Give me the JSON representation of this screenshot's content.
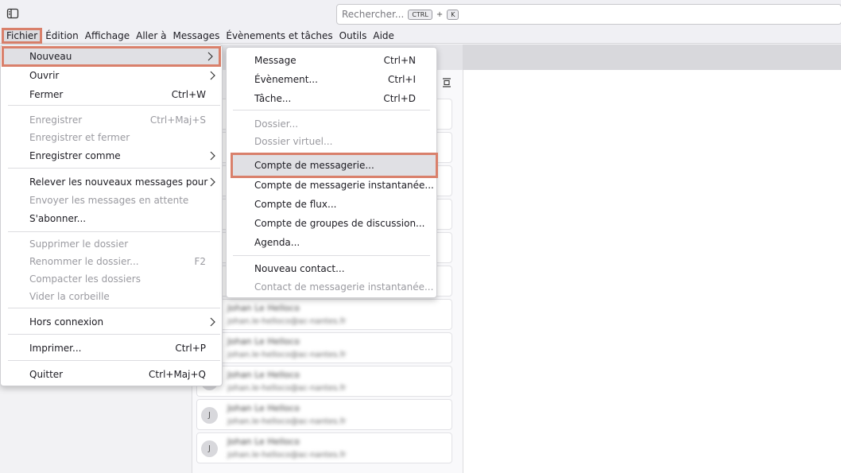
{
  "search": {
    "placeholder": "Rechercher...",
    "key1": "CTRL",
    "plus": "+",
    "key2": "K"
  },
  "menubar": [
    {
      "label": "Fichier",
      "active": true
    },
    {
      "label": "Édition"
    },
    {
      "label": "Affichage"
    },
    {
      "label": "Aller à"
    },
    {
      "label": "Messages"
    },
    {
      "label": "Évènements et tâches"
    },
    {
      "label": "Outils"
    },
    {
      "label": "Aide"
    }
  ],
  "file_menu": {
    "items": [
      {
        "label": "Nouveau",
        "shortcut": "",
        "submenu": true,
        "highlighted": true
      },
      {
        "label": "Ouvrir",
        "shortcut": "",
        "submenu": true
      },
      {
        "label": "Fermer",
        "shortcut": "Ctrl+W"
      },
      {
        "label": "Enregistrer",
        "shortcut": "Ctrl+Maj+S",
        "disabled": true
      },
      {
        "label": "Enregistrer et fermer",
        "shortcut": "",
        "disabled": true
      },
      {
        "label": "Enregistrer comme",
        "shortcut": "",
        "submenu": true
      },
      {
        "label": "Relever les nouveaux messages pour",
        "shortcut": "",
        "submenu": true
      },
      {
        "label": "Envoyer les messages en attente",
        "shortcut": "",
        "disabled": true
      },
      {
        "label": "S'abonner...",
        "shortcut": ""
      },
      {
        "label": "Supprimer le dossier",
        "shortcut": "",
        "disabled": true
      },
      {
        "label": "Renommer le dossier...",
        "shortcut": "F2",
        "disabled": true
      },
      {
        "label": "Compacter les dossiers",
        "shortcut": "",
        "disabled": true
      },
      {
        "label": "Vider la corbeille",
        "shortcut": "",
        "disabled": true
      },
      {
        "label": "Hors connexion",
        "shortcut": "",
        "submenu": true
      },
      {
        "label": "Imprimer...",
        "shortcut": "Ctrl+P"
      },
      {
        "label": "Quitter",
        "shortcut": "Ctrl+Maj+Q"
      }
    ]
  },
  "new_submenu": {
    "items": [
      {
        "label": "Message",
        "shortcut": "Ctrl+N"
      },
      {
        "label": "Évènement...",
        "shortcut": "Ctrl+I"
      },
      {
        "label": "Tâche...",
        "shortcut": "Ctrl+D"
      },
      {
        "label": "Dossier...",
        "shortcut": "",
        "disabled": true
      },
      {
        "label": "Dossier virtuel...",
        "shortcut": "",
        "disabled": true
      },
      {
        "label": "Compte de messagerie...",
        "shortcut": "",
        "highlighted": true
      },
      {
        "label": "Compte de messagerie instantanée...",
        "shortcut": ""
      },
      {
        "label": "Compte de flux...",
        "shortcut": ""
      },
      {
        "label": "Compte de groupes de discussion...",
        "shortcut": ""
      },
      {
        "label": "Agenda...",
        "shortcut": ""
      },
      {
        "label": "Nouveau contact...",
        "shortcut": ""
      },
      {
        "label": "Contact de messagerie instantanée...",
        "shortcut": "",
        "disabled": true
      }
    ]
  },
  "contacts": [
    {
      "avatar": "",
      "name": "",
      "email": ""
    },
    {
      "avatar": "",
      "name": "",
      "email": ""
    },
    {
      "avatar": "",
      "name": "",
      "email": ""
    },
    {
      "avatar": "",
      "name": "",
      "email": ""
    },
    {
      "avatar": "",
      "name": "",
      "email": ""
    },
    {
      "avatar": "",
      "name": "",
      "email": ""
    },
    {
      "avatar": "",
      "name": "Johan Le Helloco",
      "email": "johan.le-helloco@ac-nantes.fr"
    },
    {
      "avatar": "",
      "name": "Johan Le Helloco",
      "email": "johan.le-helloco@ac-nantes.fr"
    },
    {
      "avatar": "",
      "name": "Johan Le Helloco",
      "email": "johan.le-helloco@ac-nantes.fr"
    },
    {
      "avatar": "J",
      "name": "Johan Le Helloco",
      "email": "johan.le-helloco@ac-nantes.fr"
    },
    {
      "avatar": "J",
      "name": "Johan Le Helloco",
      "email": "johan.le-helloco@ac-nantes.fr"
    }
  ],
  "colors": {
    "highlight_box": "#d9806b",
    "menu_hover": "#e0e0e4"
  }
}
